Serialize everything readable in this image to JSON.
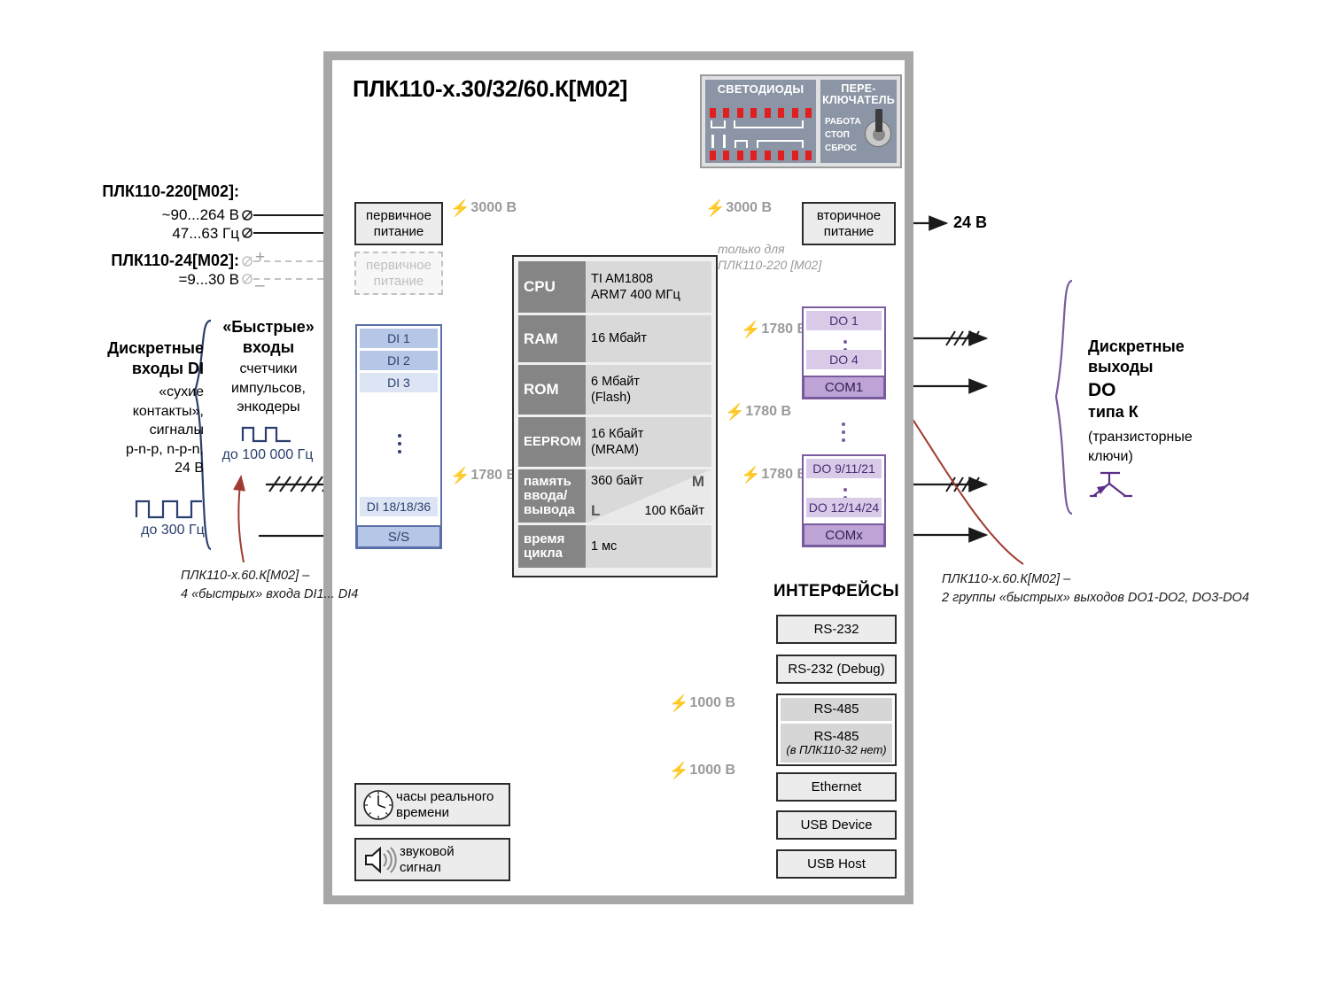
{
  "title": "ПЛК110-x.30/32/60.К[М02]",
  "panel": {
    "leds_heading": "СВЕТОДИОДЫ",
    "switch_heading": "ПЕРЕ-\nКЛЮЧАТЕЛЬ",
    "switch_heading_line1": "ПЕРЕ-",
    "switch_heading_line2": "КЛЮЧАТЕЛЬ",
    "switch_positions": [
      "РАБОТА",
      "СТОП",
      "СБРОС"
    ],
    "led_count_per_row": 8,
    "led_color": "#e02020",
    "panel_bg": "#8b95a5"
  },
  "power": {
    "src220_title": "ПЛК110-220[М02]:",
    "src220_line1": "~90...264 В",
    "src220_line2": "47...63 Гц",
    "src24_title": "ПЛК110-24[М02]:",
    "src24_line1": "=9...30 В",
    "src24_plus": "+",
    "src24_minus": "–",
    "primary_box": "первичное\nпитание",
    "primary_box_l1": "первичное",
    "primary_box_l2": "питание",
    "primary_box_dim_l1": "первичное",
    "primary_box_dim_l2": "питание",
    "secondary_box_l1": "вторичное",
    "secondary_box_l2": "питание",
    "output_24v": "24 В",
    "iso_3000_left": "3000 В",
    "iso_3000_right": "3000 В",
    "note_l1": "только для",
    "note_l2": "ПЛК110-220 [М02]"
  },
  "di": {
    "group_title_l1": "Дискретные",
    "group_title_l2": "входы DI",
    "desc_l1": "«сухие",
    "desc_l2": "контакты»,",
    "desc_l3": "сигналы",
    "desc_l4": "p-n-p, n-p-n,",
    "desc_l5": "24 В",
    "freq_slow": "до 300 Гц",
    "fast_title_l1": "«Быстрые»",
    "fast_title_l2": "входы",
    "fast_desc_l1": "счетчики",
    "fast_desc_l2": "импульсов,",
    "fast_desc_l3": "энкодеры",
    "freq_fast": "до 100 000 Гц",
    "cells": [
      "DI 1",
      "DI 2",
      "DI 3"
    ],
    "cell_last": "DI 18/18/36",
    "common": "S/S",
    "iso": "1780 В",
    "note_l1": "ПЛК110-x.60.К[М02] –",
    "note_l2": "4 «быстрых» входа DI1... DI4"
  },
  "cpu": {
    "rows": [
      {
        "key": "CPU",
        "val_l1": "TI AM1808",
        "val_l2": "ARM7  400 МГц"
      },
      {
        "key": "RAM",
        "val_l1": "16 Мбайт",
        "val_l2": ""
      },
      {
        "key": "ROM",
        "val_l1": "6 Мбайт",
        "val_l2": "(Flash)"
      },
      {
        "key": "EEPROM",
        "val_l1": "16 Кбайт",
        "val_l2": "(MRAM)"
      }
    ],
    "io_key_l1": "память",
    "io_key_l2": "ввода/",
    "io_key_l3": "вывода",
    "io_top": "360 байт",
    "io_M": "M",
    "io_L": "L",
    "io_bot": "100 Кбайт",
    "cycle_key_l1": "время",
    "cycle_key_l2": "цикла",
    "cycle_val": "1 мс"
  },
  "do": {
    "group_title_l1": "Дискретные",
    "group_title_l2": "выходы",
    "group_title_l3": "DO",
    "group_title_l4": "типа К",
    "desc_l1": "(транзисторные",
    "desc_l2": "ключи)",
    "block1": {
      "first": "DO 1",
      "last": "DO 4",
      "com": "COM1"
    },
    "block2": {
      "first": "DO 9/11/21",
      "last": "DO 12/14/24",
      "com": "COMx"
    },
    "iso1": "1780 В",
    "iso2": "1780 В",
    "iso3": "1780 В",
    "note_l1": "ПЛК110-x.60.К[М02] –",
    "note_l2": "2 группы «быстрых» выходов DO1-DO2, DO3-DO4"
  },
  "interfaces": {
    "heading": "ИНТЕРФЕЙСЫ",
    "items": [
      {
        "label": "RS-232",
        "sub": ""
      },
      {
        "label": "RS-232 (Debug)",
        "sub": ""
      },
      {
        "label": "RS-485",
        "sub": ""
      },
      {
        "label": "RS-485",
        "sub": "(в ПЛК110-32 нет)"
      },
      {
        "label": "Ethernet",
        "sub": ""
      },
      {
        "label": "USB Device",
        "sub": ""
      },
      {
        "label": "USB Host",
        "sub": ""
      }
    ],
    "iso_rs485": "1000 В",
    "iso_eth": "1000 В"
  },
  "peripherals": {
    "rtc_l1": "часы реального",
    "rtc_l2": "времени",
    "buzzer_l1": "звуковой",
    "buzzer_l2": "сигнал"
  },
  "colors": {
    "frame": "#a7a7a7",
    "di_accent": "#5b6fa8",
    "do_accent": "#7a5c9e",
    "led_red": "#e02020",
    "annotation_red": "#a03b31",
    "gray_text": "#9a9a9a"
  }
}
